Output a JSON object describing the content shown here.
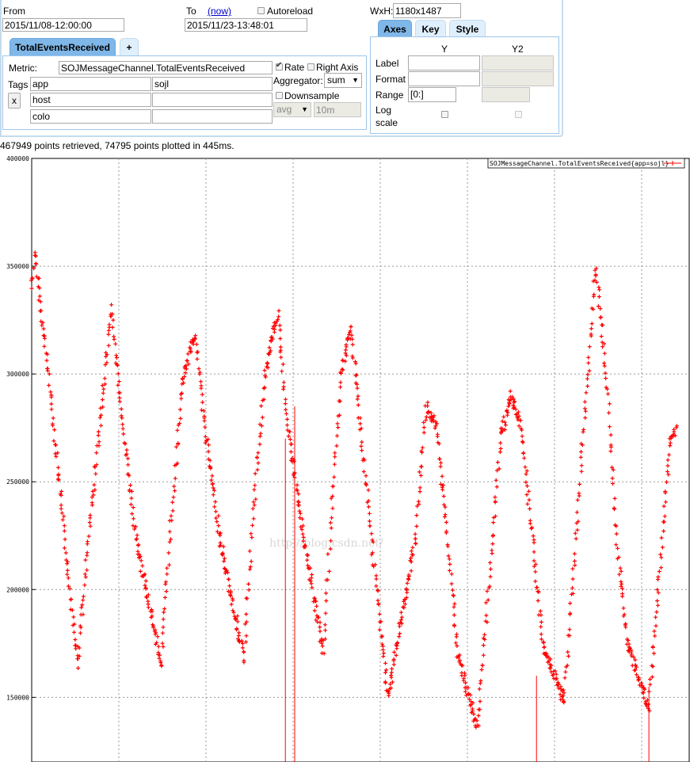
{
  "query": {
    "from_label": "From",
    "from_value": "2015/11/08-12:00:00",
    "to_label": "To",
    "to_now_link": "(now)",
    "to_value": "2015/11/23-13:48:01",
    "autoreload_label": "Autoreload",
    "autoreload_checked": false,
    "wxh_label": "WxH:",
    "wxh_value": "1180x1487"
  },
  "metric_tabs": [
    {
      "label": "TotalEventsReceived",
      "active": true
    },
    {
      "label": "+",
      "active": false
    }
  ],
  "metric_panel": {
    "metric_label": "Metric:",
    "metric_value": "SOJMessageChannel.TotalEventsReceived",
    "rate_label": "Rate",
    "rate_checked": true,
    "right_axis_label": "Right Axis",
    "right_axis_checked": false,
    "aggregator_label": "Aggregator:",
    "aggregator_value": "sum",
    "downsample_label": "Downsample",
    "downsample_checked": false,
    "downsample_func": "avg",
    "downsample_interval": "10m",
    "tags_label": "Tags",
    "remove_tag_button": "x",
    "tags": [
      {
        "key": "app",
        "value": "sojl"
      },
      {
        "key": "host",
        "value": ""
      },
      {
        "key": "colo",
        "value": ""
      }
    ]
  },
  "options_tabs": [
    {
      "label": "Axes",
      "active": true
    },
    {
      "label": "Key",
      "active": false
    },
    {
      "label": "Style",
      "active": false
    }
  ],
  "axes_panel": {
    "col_y": "Y",
    "col_y2": "Y2",
    "label_row": "Label",
    "format_row": "Format",
    "range_row": "Range",
    "range_y_value": "[0:]",
    "log_row_line1": "Log",
    "log_row_line2": "scale"
  },
  "status_text": "467949 points retrieved, 74795 points plotted in 445ms.",
  "watermark": "http://blog.csdn.net/",
  "colors": {
    "series": "#ff0000",
    "panel_border": "#9ec6ea",
    "tab_active": "#7fb7e8",
    "tab_inactive": "#dfeffc"
  },
  "chart_data": {
    "type": "line",
    "ylim": [
      120000,
      400000
    ],
    "ytick_labels": [
      "150000",
      "200000",
      "250000",
      "300000",
      "350000",
      "400000"
    ],
    "yticks": [
      150000,
      200000,
      250000,
      300000,
      350000,
      400000
    ],
    "legend": "top-right",
    "grid": true,
    "series": [
      {
        "name": "SOJMessageChannel.TotalEventsReceived{app=sojl}",
        "x": [
          0,
          0.08,
          0.45,
          1.08,
          1.35,
          1.55,
          1.88,
          2.08,
          2.45,
          3.05,
          3.28,
          3.55,
          3.85,
          4.05,
          4.45,
          5.0,
          5.2,
          5.5,
          5.8,
          6.0,
          6.45,
          6.88,
          7.05,
          7.3,
          7.52,
          7.78,
          8.05,
          8.4,
          9.05,
          9.3,
          9.55,
          9.8,
          10.05,
          10.5,
          11.05,
          11.3,
          11.55,
          11.8,
          12.05,
          12.55,
          13.05,
          13.3,
          13.55,
          13.8,
          14.05,
          14.55,
          15.05,
          15.2
        ],
        "values": [
          340000,
          355000,
          290000,
          165000,
          225000,
          265000,
          330000,
          290000,
          225000,
          165000,
          230000,
          295000,
          320000,
          280000,
          222000,
          168000,
          230000,
          300000,
          328000,
          280000,
          220000,
          170000,
          230000,
          300000,
          322000,
          270000,
          215000,
          150000,
          225000,
          285000,
          275000,
          225000,
          170000,
          135000,
          270000,
          290000,
          275000,
          225000,
          175000,
          148000,
          285000,
          350000,
          300000,
          220000,
          175000,
          145000,
          270000,
          275000
        ]
      }
    ]
  }
}
